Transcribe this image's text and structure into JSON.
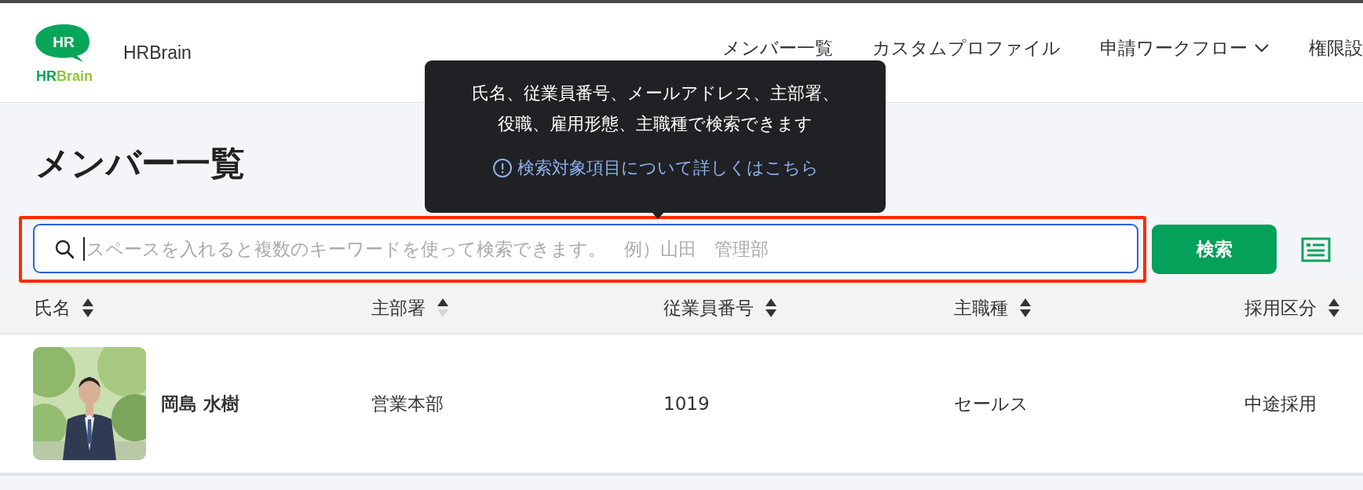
{
  "header": {
    "logo": {
      "mark": "HR",
      "wordmark_dark": "HR",
      "wordmark_light": "Brain"
    },
    "app_name": "HRBrain",
    "nav": [
      {
        "label": "メンバー一覧",
        "dropdown": false
      },
      {
        "label": "カスタムプロファイル",
        "dropdown": false
      },
      {
        "label": "申請ワークフロー",
        "dropdown": true
      },
      {
        "label": "権限設",
        "dropdown": false
      }
    ]
  },
  "page_title": "メンバー一覧",
  "tooltip": {
    "lines": [
      "氏名、従業員番号、メールアドレス、主部署、",
      "役職、雇用形態、主職種で検索できます"
    ],
    "link": "検索対象項目について詳しくはこちら"
  },
  "search": {
    "placeholder": "スペースを入れると複数のキーワードを使って検索できます。　例）山田　管理部",
    "button": "検索",
    "highlighted": true
  },
  "table": {
    "columns": [
      {
        "label": "氏名",
        "sorted": false
      },
      {
        "label": "主部署",
        "sorted": true
      },
      {
        "label": "従業員番号",
        "sorted": false
      },
      {
        "label": "主職種",
        "sorted": false
      },
      {
        "label": "採用区分",
        "sorted": false
      }
    ],
    "rows": [
      {
        "cells": [
          "岡島 水樹",
          "営業本部",
          "1019",
          "セールス",
          "中途採用"
        ]
      }
    ]
  }
}
